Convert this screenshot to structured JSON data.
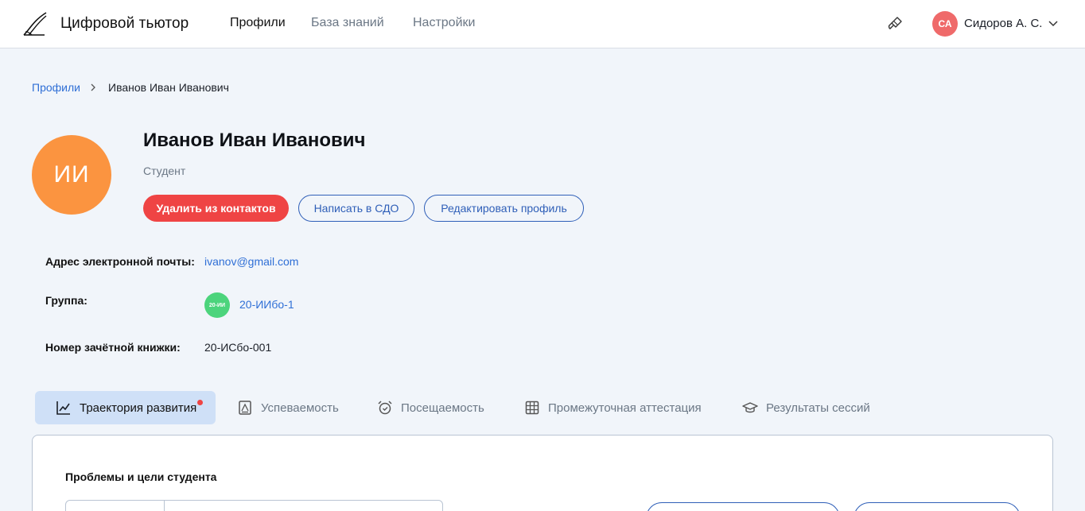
{
  "app": {
    "title": "Цифровой тьютор"
  },
  "nav": {
    "profiles": "Профили",
    "knowledge": "База знаний",
    "settings": "Настройки"
  },
  "user": {
    "initials": "СА",
    "name": "Сидоров А. С."
  },
  "breadcrumb": {
    "root": "Профили",
    "current": "Иванов Иван Иванович"
  },
  "profile": {
    "initials": "ИИ",
    "name": "Иванов Иван Иванович",
    "role": "Студент",
    "actions": {
      "delete": "Удалить из контактов",
      "message": "Написать в СДО",
      "edit": "Редактировать профиль"
    }
  },
  "info": {
    "email_label": "Адрес электронной почты:",
    "email_value": "ivanov@gmail.com",
    "group_label": "Группа:",
    "group_badge": "20-ИИ",
    "group_value": "20-ИИбо-1",
    "record_label": "Номер зачётной книжки:",
    "record_value": "20-ИСбо-001"
  },
  "tabs": [
    {
      "label": "Траектория развития",
      "icon": "chart-line-icon",
      "active": true,
      "has_notification": true
    },
    {
      "label": "Успеваемость",
      "icon": "document-icon",
      "active": false
    },
    {
      "label": "Посещаемость",
      "icon": "alarm-clock-icon",
      "active": false
    },
    {
      "label": "Промежуточная аттестация",
      "icon": "table-icon",
      "active": false
    },
    {
      "label": "Результаты сессий",
      "icon": "graduation-cap-icon",
      "active": false
    }
  ],
  "section": {
    "title": "Проблемы и цели студента"
  },
  "colors": {
    "accent": "#2f6fd6",
    "danger": "#ef4444",
    "avatar": "#fb9440",
    "user_avatar": "#ef6a6a",
    "group_badge": "#4cd47c",
    "active_tab": "#cfe0f7",
    "background": "#f1f5fa"
  }
}
